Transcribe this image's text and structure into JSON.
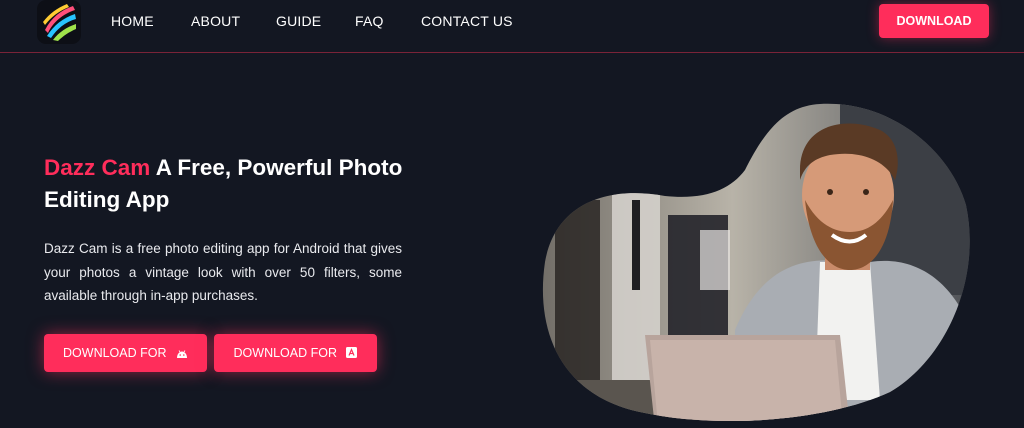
{
  "nav": {
    "items": [
      "HOME",
      "ABOUT",
      "GUIDE",
      "FAQ",
      "CONTACT US"
    ],
    "download_label": "DOWNLOAD"
  },
  "hero": {
    "title_brand": "Dazz Cam",
    "title_rest": "A Free, Powerful Photo Editing App",
    "description": "Dazz Cam is a free photo editing app for Android that gives your photos a vintage look with over 50 filters, some available through in-app purchases.",
    "buttons": [
      {
        "label": "DOWNLOAD FOR",
        "icon": "android-icon"
      },
      {
        "label": "DOWNLOAD FOR",
        "icon": "apple-store-icon"
      }
    ]
  },
  "colors": {
    "accent": "#ff2d5b",
    "background": "#131722"
  }
}
